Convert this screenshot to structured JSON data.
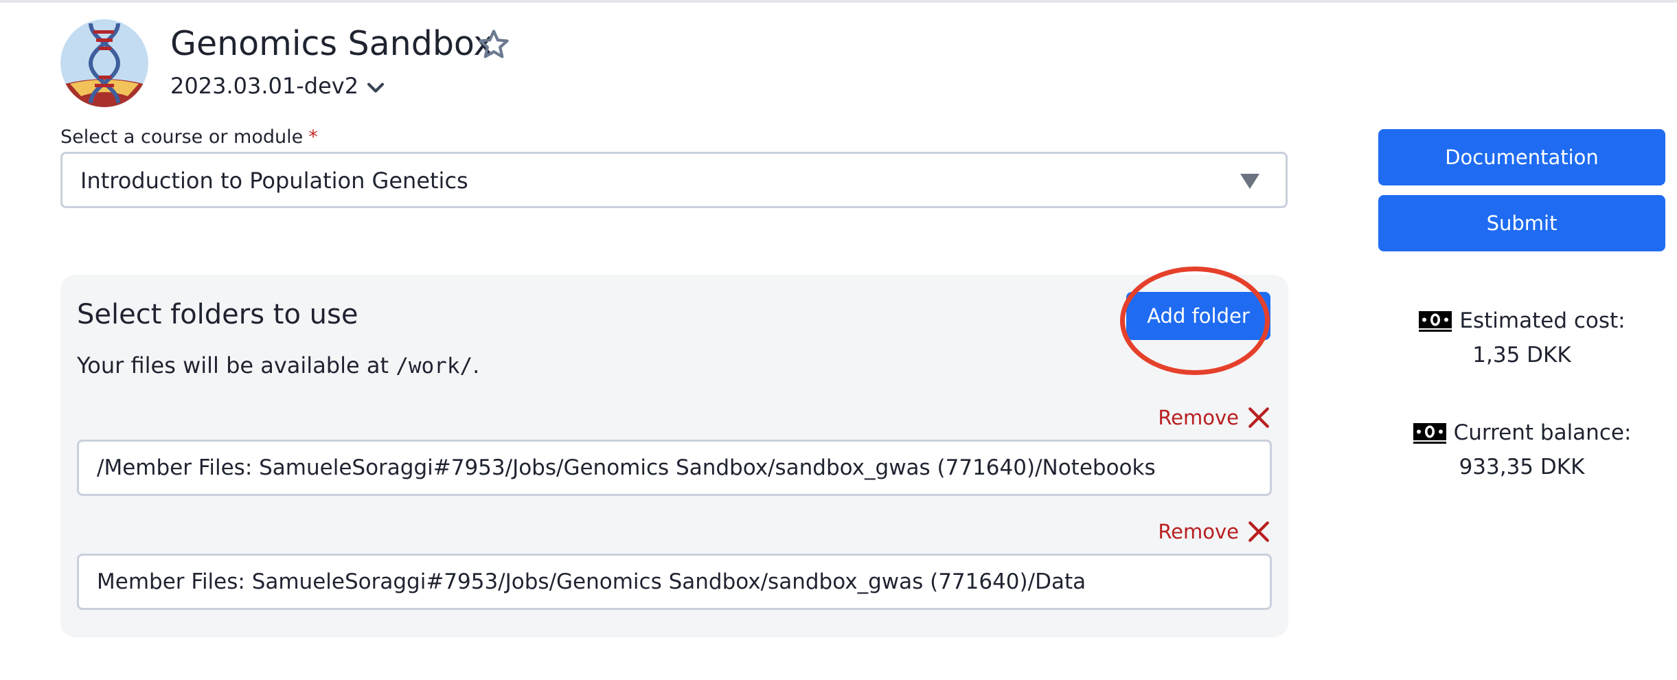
{
  "app": {
    "title": "Genomics Sandbox",
    "version": "2023.03.01-dev2",
    "logo_icon": "dna-logo-icon",
    "star_icon": "star-outline-icon"
  },
  "course": {
    "label": "Select a course or module",
    "required_mark": "*",
    "selected": "Introduction to Population Genetics"
  },
  "folders": {
    "title": "Select folders to use",
    "hint_prefix": "Your files will be available at ",
    "hint_path": "/work/",
    "hint_suffix": ".",
    "add_label": "Add folder",
    "remove_label": "Remove",
    "items": [
      {
        "path": "/Member Files: SamueleSoraggi#7953/Jobs/Genomics Sandbox/sandbox_gwas (771640)/Notebooks"
      },
      {
        "path": "Member Files: SamueleSoraggi#7953/Jobs/Genomics Sandbox/sandbox_gwas (771640)/Data"
      }
    ]
  },
  "sidebar": {
    "documentation_label": "Documentation",
    "submit_label": "Submit",
    "estimated_cost_label": "Estimated cost:",
    "estimated_cost_value": "1,35 DKK",
    "balance_label": "Current balance:",
    "balance_value": "933,35 DKK",
    "money_icon": "money-icon"
  },
  "colors": {
    "primary": "#1f6cf2",
    "danger": "#b81f1f",
    "required": "#c62828",
    "highlight": "#e5402b",
    "panel_bg": "#f4f5f7",
    "border": "#c9d0dc"
  }
}
